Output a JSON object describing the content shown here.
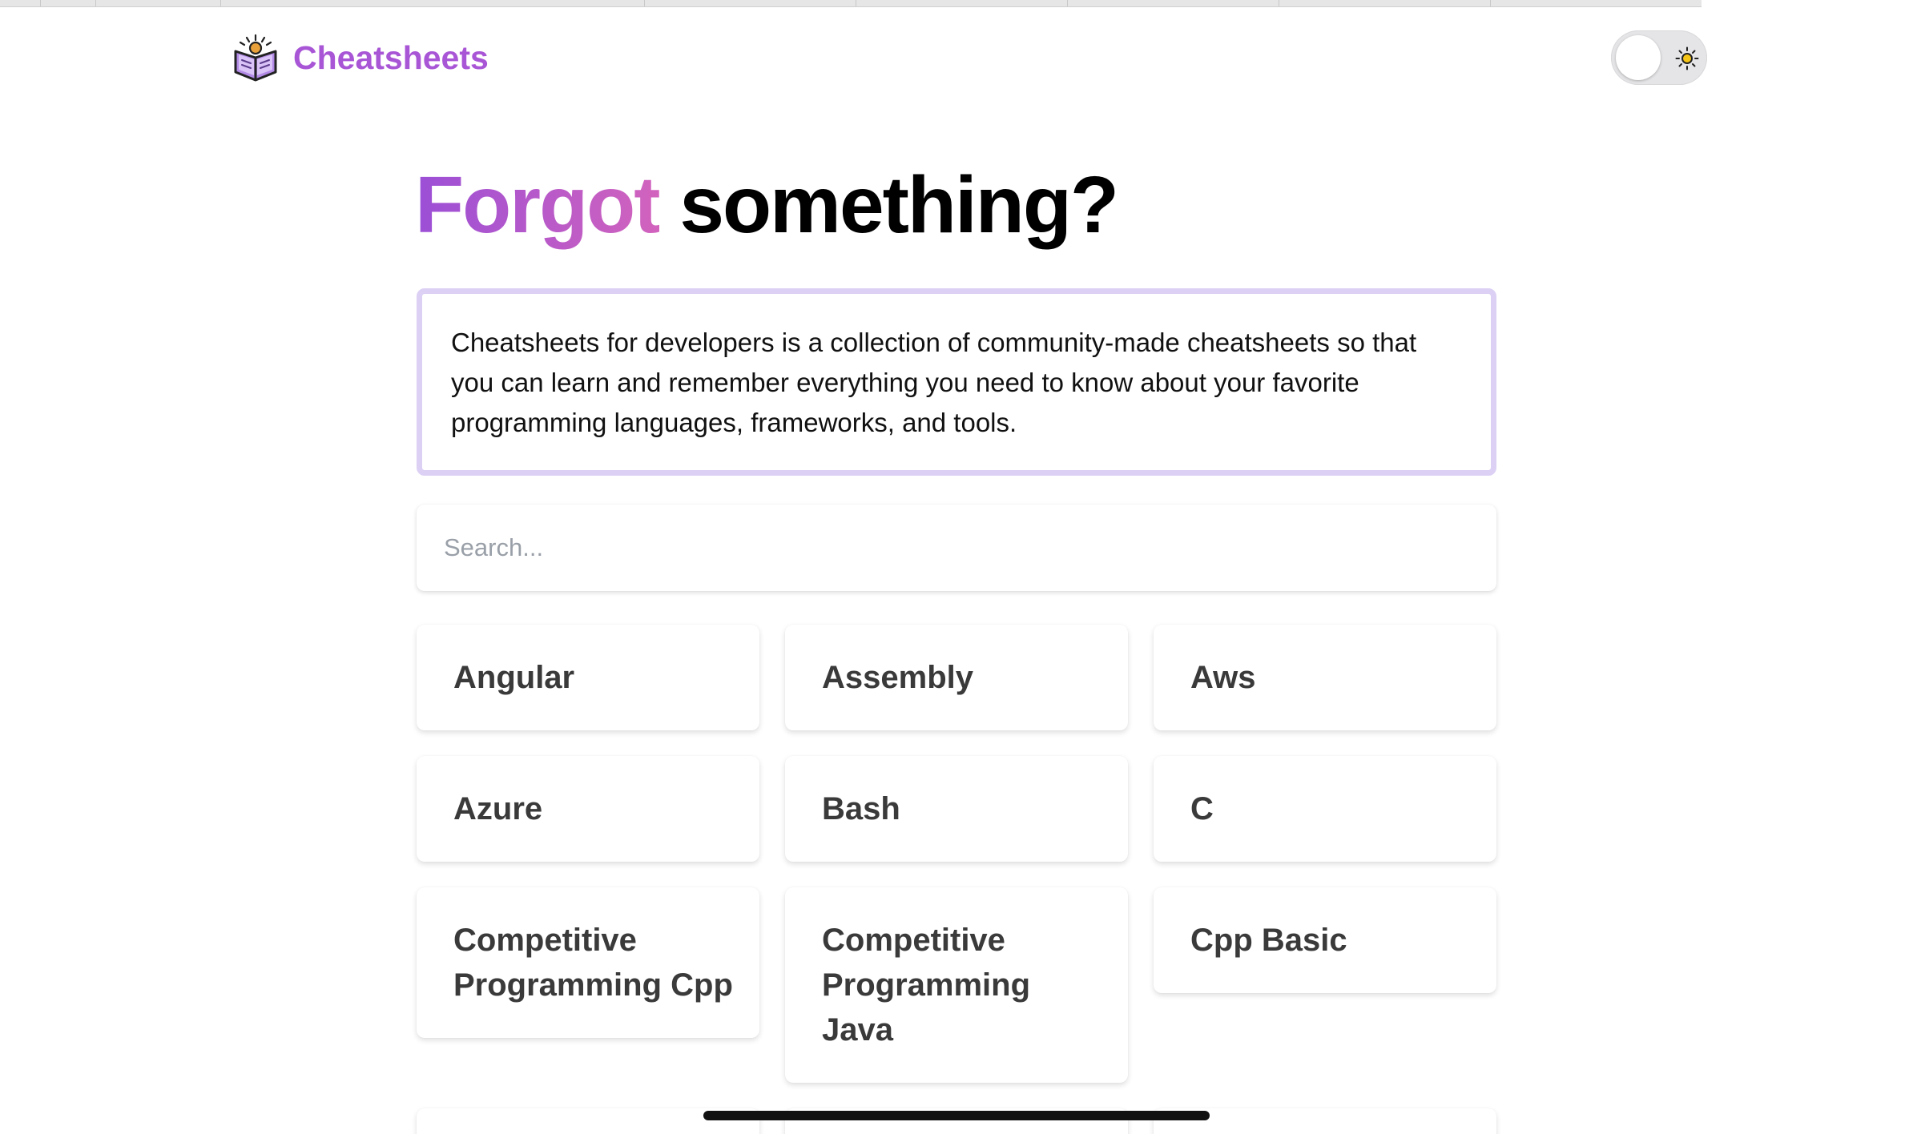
{
  "brand": {
    "name": "Cheatsheets",
    "logo_icon": "book-icon",
    "color": "#a855d6"
  },
  "theme_toggle": {
    "icon": "sun-icon",
    "state": "light"
  },
  "hero": {
    "headline_accent": "Forgot",
    "headline_rest": " something?",
    "accent_gradient": [
      "#9b4fd6",
      "#d263bd"
    ],
    "description": "Cheatsheets for developers is a collection of community-made cheatsheets so that you can learn and remember everything you need to know about your favorite programming languages, frameworks, and tools.",
    "border_color": "#dcd0f5"
  },
  "search": {
    "placeholder": "Search...",
    "value": ""
  },
  "cheatsheets": [
    "Angular",
    "Assembly",
    "Aws",
    "Azure",
    "Bash",
    "C",
    "Competitive Programming Cpp",
    "Competitive Programming Java",
    "Cpp Basic"
  ]
}
